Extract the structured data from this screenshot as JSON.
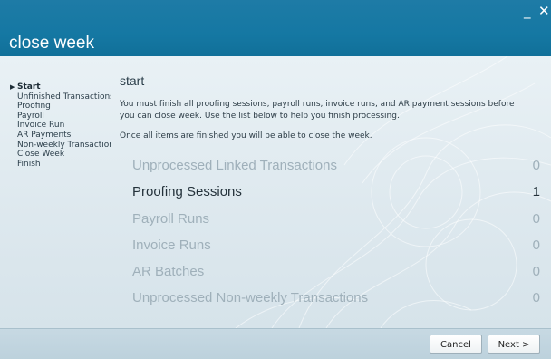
{
  "window": {
    "title": "close week",
    "minimize_glyph": "_",
    "close_glyph": "✕"
  },
  "sidebar": {
    "items": [
      {
        "label": "Start",
        "active": true
      },
      {
        "label": "Unfinished Transactions",
        "active": false
      },
      {
        "label": "Proofing",
        "active": false
      },
      {
        "label": "Payroll",
        "active": false
      },
      {
        "label": "Invoice Run",
        "active": false
      },
      {
        "label": "AR Payments",
        "active": false
      },
      {
        "label": "Non-weekly Transactions",
        "active": false
      },
      {
        "label": "Close Week",
        "active": false
      },
      {
        "label": "Finish",
        "active": false
      }
    ]
  },
  "main": {
    "heading": "start",
    "paragraph1": "You must finish all proofing sessions, payroll runs, invoice runs, and AR payment sessions before you can close week. Use the list below to help you finish processing.",
    "paragraph2": "Once all items are finished you will be able to close the week.",
    "items": [
      {
        "name": "Unprocessed Linked Transactions",
        "count": "0",
        "current": false
      },
      {
        "name": "Proofing Sessions",
        "count": "1",
        "current": true
      },
      {
        "name": "Payroll Runs",
        "count": "0",
        "current": false
      },
      {
        "name": "Invoice Runs",
        "count": "0",
        "current": false
      },
      {
        "name": "AR Batches",
        "count": "0",
        "current": false
      },
      {
        "name": "Unprocessed Non-weekly Transactions",
        "count": "0",
        "current": false
      }
    ]
  },
  "footer": {
    "cancel_label": "Cancel",
    "next_label": "Next >"
  },
  "colors": {
    "titlebar": "#1578a3",
    "content_bg": "#e2ecf1",
    "inactive_item": "#9fb0ba",
    "active_item": "#24323b"
  }
}
